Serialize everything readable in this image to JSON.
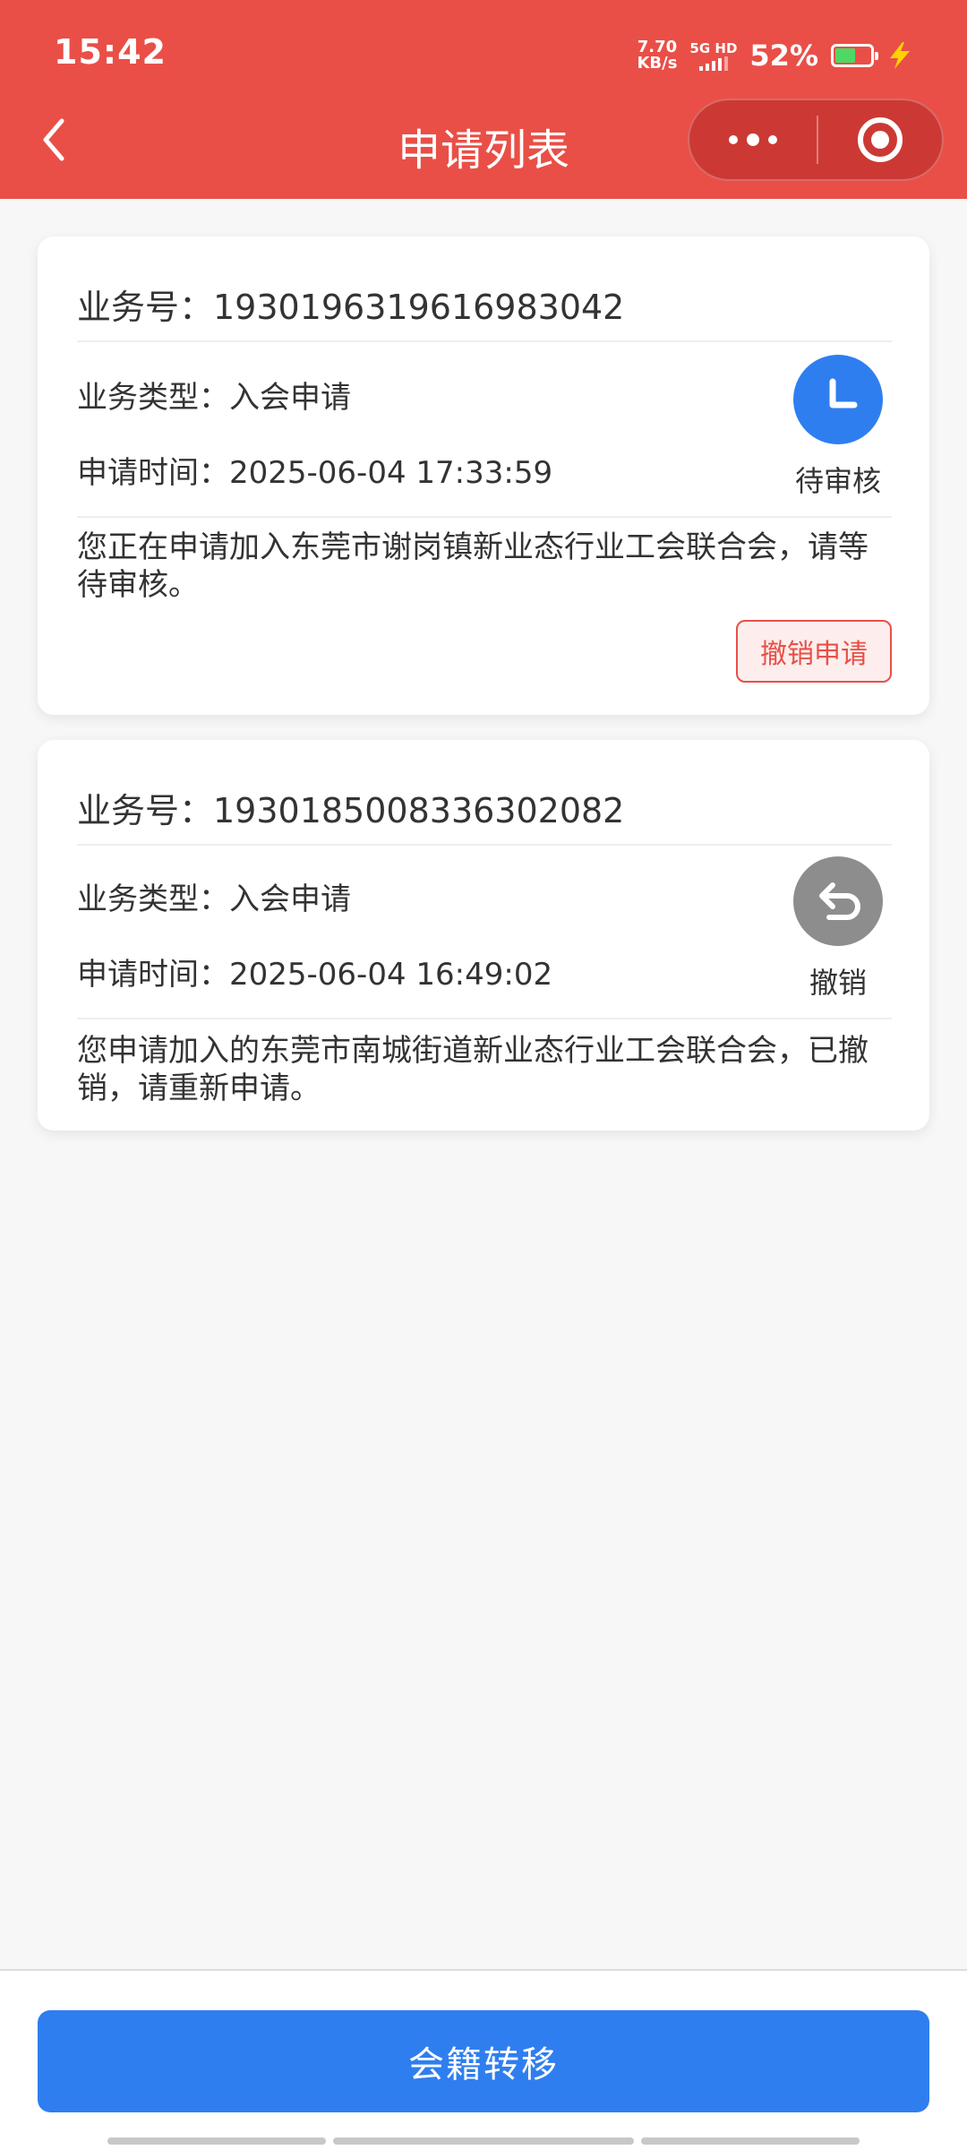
{
  "status_bar": {
    "time": "15:42",
    "net_speed_value": "7.70",
    "net_speed_unit": "KB/s",
    "network_label": "5G HD",
    "battery_percent": "52%"
  },
  "header": {
    "title": "申请列表"
  },
  "applications": [
    {
      "id_text": "业务号：1930196319616983042",
      "type_text": "业务类型：入会申请",
      "time_text": "申请时间：2025-06-04 17:33:59",
      "status_label": "待审核",
      "message": "您正在申请加入东莞市谢岗镇新业态行业工会联合会，请等待审核。",
      "action_label": "撤销申请"
    },
    {
      "id_text": "业务号：1930185008336302082",
      "type_text": "业务类型：入会申请",
      "time_text": "申请时间：2025-06-04 16:49:02",
      "status_label": "撤销",
      "message": "您申请加入的东莞市南城街道新业态行业工会联合会，已撤销，请重新申请。"
    }
  ],
  "footer": {
    "transfer_button_label": "会籍转移"
  },
  "colors": {
    "header_red": "#e94f47",
    "primary_blue": "#2f7ef0",
    "revoked_gray": "#8d8d8d"
  },
  "icons": {
    "pending": "clock-icon",
    "revoked": "undo-icon",
    "back": "chevron-left-icon",
    "more": "more-icon",
    "close": "target-icon"
  }
}
